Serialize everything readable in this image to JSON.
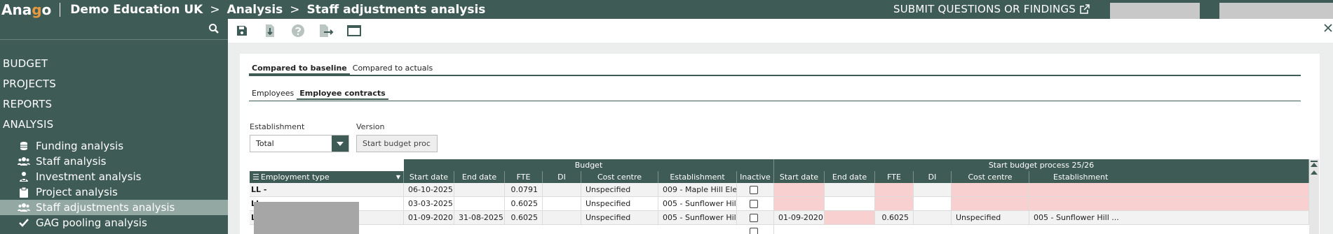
{
  "header": {
    "logo_pre": "Ana",
    "logo_g": "g",
    "logo_post": "o",
    "breadcrumbs": [
      "Demo Education UK",
      "Analysis",
      "Staff adjustments analysis"
    ],
    "separator": ">",
    "submit_label": "SUBMIT QUESTIONS OR FINDINGS"
  },
  "sidebar": {
    "sections": [
      "BUDGET",
      "PROJECTS",
      "REPORTS",
      "ANALYSIS"
    ],
    "items": [
      {
        "label": "Funding analysis",
        "icon": "coins-icon"
      },
      {
        "label": "Staff analysis",
        "icon": "users-icon"
      },
      {
        "label": "Investment analysis",
        "icon": "investment-icon"
      },
      {
        "label": "Project analysis",
        "icon": "clipboard-icon"
      },
      {
        "label": "Staff adjustments analysis",
        "icon": "users-icon",
        "active": true
      },
      {
        "label": "GAG pooling analysis",
        "icon": "check-icon"
      }
    ]
  },
  "toolbar": {
    "icons": [
      "save-icon",
      "download-icon",
      "help-icon",
      "export-icon",
      "window-icon"
    ]
  },
  "tabs": {
    "primary": [
      {
        "label": "Compared to baseline",
        "active": true
      },
      {
        "label": "Compared to actuals",
        "active": false
      }
    ],
    "secondary": [
      {
        "label": "Employees",
        "active": false
      },
      {
        "label": "Employee contracts",
        "active": true
      }
    ]
  },
  "filters": {
    "establishment_label": "Establishment",
    "establishment_value": "Total",
    "version_label": "Version",
    "version_value": "Start budget proc"
  },
  "table": {
    "group_budget": "Budget",
    "group_start": "Start budget process 25/26",
    "first_col": "Employment type",
    "budget_cols": [
      "Start date",
      "End date",
      "FTE",
      "DI",
      "Cost centre",
      "Establishment",
      "Inactive"
    ],
    "start_cols": [
      "Start date",
      "End date",
      "FTE",
      "DI",
      "Cost centre",
      "Establishment"
    ],
    "rows": [
      {
        "type": "LL -",
        "b_start": "06-10-2025",
        "b_end": "",
        "b_fte": "0.0791",
        "b_di": "",
        "b_cc": "Unspecified",
        "b_est": "009 - Maple Hill Ele...",
        "s_start": "",
        "s_end": "",
        "s_fte": "",
        "s_di": "",
        "s_cc": "",
        "s_est": ""
      },
      {
        "type": "LL -",
        "b_start": "03-03-2025",
        "b_end": "",
        "b_fte": "0.6025",
        "b_di": "",
        "b_cc": "Unspecified",
        "b_est": "005 - Sunflower Hill ...",
        "s_start": "",
        "s_end": "",
        "s_fte": "",
        "s_di": "",
        "s_cc": "",
        "s_est": ""
      },
      {
        "type": "LL -",
        "b_start": "01-09-2020",
        "b_end": "31-08-2025",
        "b_fte": "0.6025",
        "b_di": "",
        "b_cc": "Unspecified",
        "b_est": "005 - Sunflower Hill ...",
        "s_start": "01-09-2020",
        "s_end": "",
        "s_fte": "0.6025",
        "s_di": "",
        "s_cc": "Unspecified",
        "s_est": "005 - Sunflower Hill ..."
      }
    ]
  },
  "colors": {
    "brand": "#3f5b55",
    "accent": "#e59a42",
    "active_nav": "#93a8a2",
    "changed_cell": "#f8d0d0"
  }
}
